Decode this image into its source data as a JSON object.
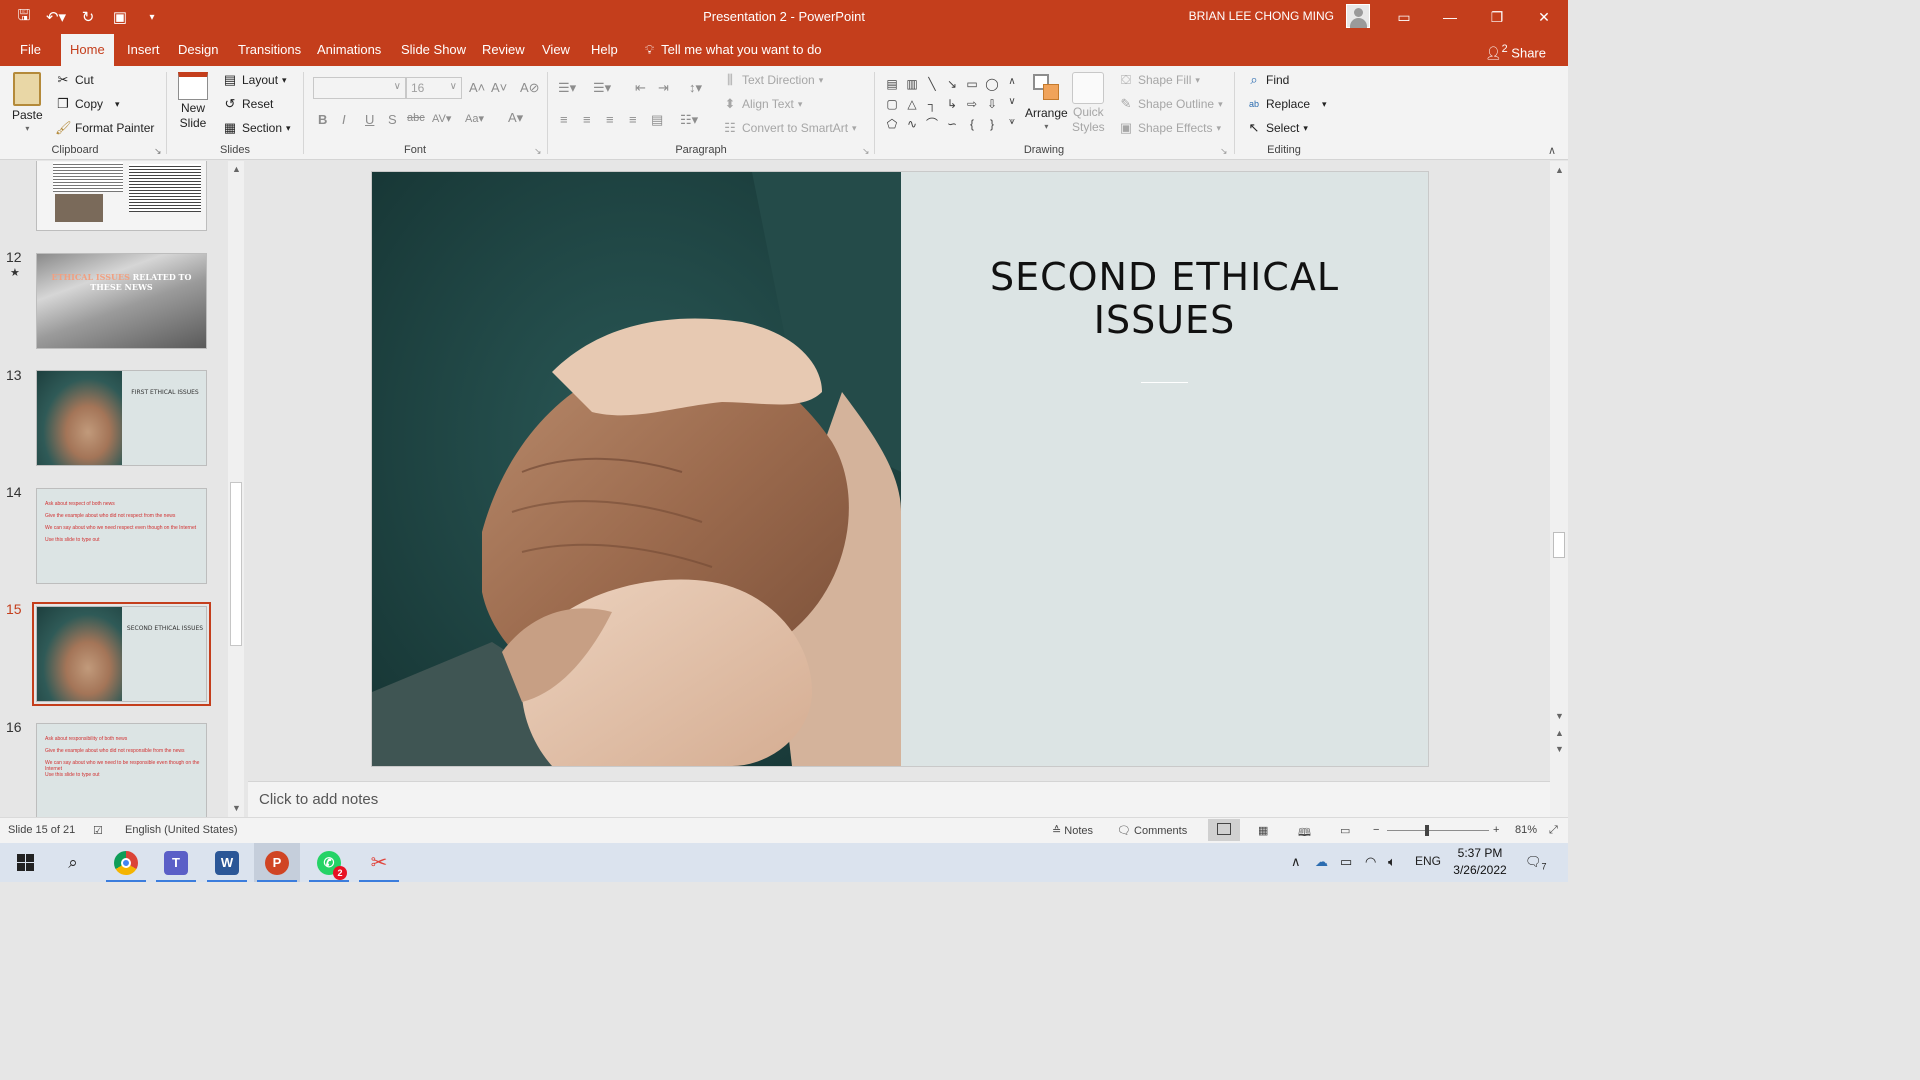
{
  "app": {
    "window_title": "Presentation 2  -  PowerPoint",
    "user_name": "BRIAN LEE CHONG MING",
    "share_label": "Share",
    "share_count": "2"
  },
  "tabs": [
    "File",
    "Home",
    "Insert",
    "Design",
    "Transitions",
    "Animations",
    "Slide Show",
    "Review",
    "View",
    "Help"
  ],
  "active_tab": "Home",
  "tell_me": "Tell me what you want to do",
  "ribbon": {
    "clipboard": {
      "label": "Clipboard",
      "paste": "Paste",
      "cut": "Cut",
      "copy": "Copy",
      "format_painter": "Format Painter"
    },
    "slides": {
      "label": "Slides",
      "new_slide_1": "New",
      "new_slide_2": "Slide",
      "layout": "Layout",
      "reset": "Reset",
      "section": "Section"
    },
    "font": {
      "label": "Font",
      "font_name": "",
      "font_size": "16"
    },
    "paragraph": {
      "label": "Paragraph",
      "text_direction": "Text Direction",
      "align_text": "Align Text",
      "convert_smartart": "Convert to SmartArt"
    },
    "drawing": {
      "label": "Drawing",
      "arrange": "Arrange",
      "quick_styles_1": "Quick",
      "quick_styles_2": "Styles",
      "shape_fill": "Shape Fill",
      "shape_outline": "Shape Outline",
      "shape_effects": "Shape Effects"
    },
    "editing": {
      "label": "Editing",
      "find": "Find",
      "replace": "Replace",
      "select": "Select"
    }
  },
  "thumbnails": [
    {
      "num": "",
      "kind": "doc"
    },
    {
      "num": "12",
      "kind": "news",
      "title_hl": "ETHICAL ISSUES",
      "title_rest": " RELATED TO THESE NEWS",
      "animated": true
    },
    {
      "num": "13",
      "kind": "photo",
      "title": "FIRST ETHICAL ISSUES"
    },
    {
      "num": "14",
      "kind": "text",
      "lines": [
        "Ask about respect of both news",
        "Give the example about who did not respect from the news",
        "We can say about who we need respect even though on the Internet",
        "Use this slide to type out"
      ]
    },
    {
      "num": "15",
      "kind": "photo",
      "title": "SECOND ETHICAL ISSUES",
      "selected": true
    },
    {
      "num": "16",
      "kind": "text",
      "lines": [
        "Ask about responsibility of both news",
        "Give the example about who did not responsible from the news",
        "We can say about who we need to be responsible even though on the Internet",
        "Use this slide to type out"
      ]
    }
  ],
  "current_slide": {
    "title_line1": "SECOND ETHICAL",
    "title_line2": "ISSUES"
  },
  "notes_placeholder": "Click to add notes",
  "status": {
    "slide_info": "Slide 15 of 21",
    "language": "English (United States)",
    "notes": "Notes",
    "comments": "Comments",
    "zoom": "81%"
  },
  "taskbar": {
    "time": "5:37 PM",
    "date": "3/26/2022",
    "lang": "ENG",
    "whatsapp_badge": "2",
    "notification_count": "7"
  },
  "colors": {
    "accent": "#c43e1c",
    "slide_bg": "#dce4e4",
    "taskbar": "#dbe3ee"
  }
}
